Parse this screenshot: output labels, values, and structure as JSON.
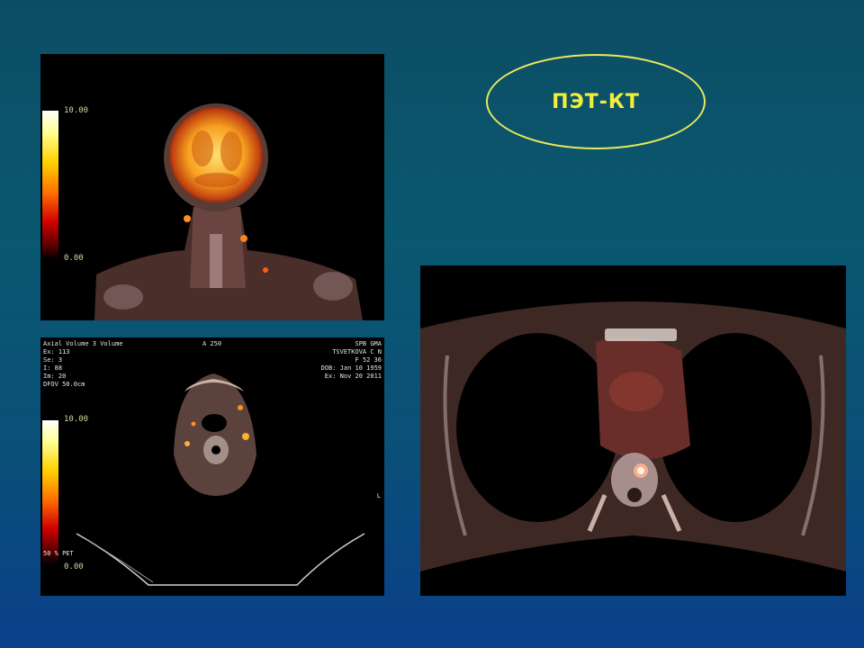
{
  "slide": {
    "title": "ПЭТ-КТ",
    "accent_color": "#f3ee3a"
  },
  "coronal_panel": {
    "scale_max": "10.00",
    "scale_min": "0.00"
  },
  "axial_neck_panel": {
    "header_left": [
      "Axial Volume 3 Volume",
      "Ex: 113",
      "Se: 3",
      "I: 88",
      "Im: 20",
      "DFOV 50.0cm"
    ],
    "header_center": "A 250",
    "header_right": [
      "SPB GMA",
      "TSVETKOVA C N",
      "F 52 36",
      "DOB: Jan 10 1959",
      "Ex: Nov 20 2011"
    ],
    "scale_max": "10.00",
    "scale_min": "0.00",
    "scale_pct": "50 % PET",
    "side_letter": "L"
  },
  "axial_chest_panel": {}
}
